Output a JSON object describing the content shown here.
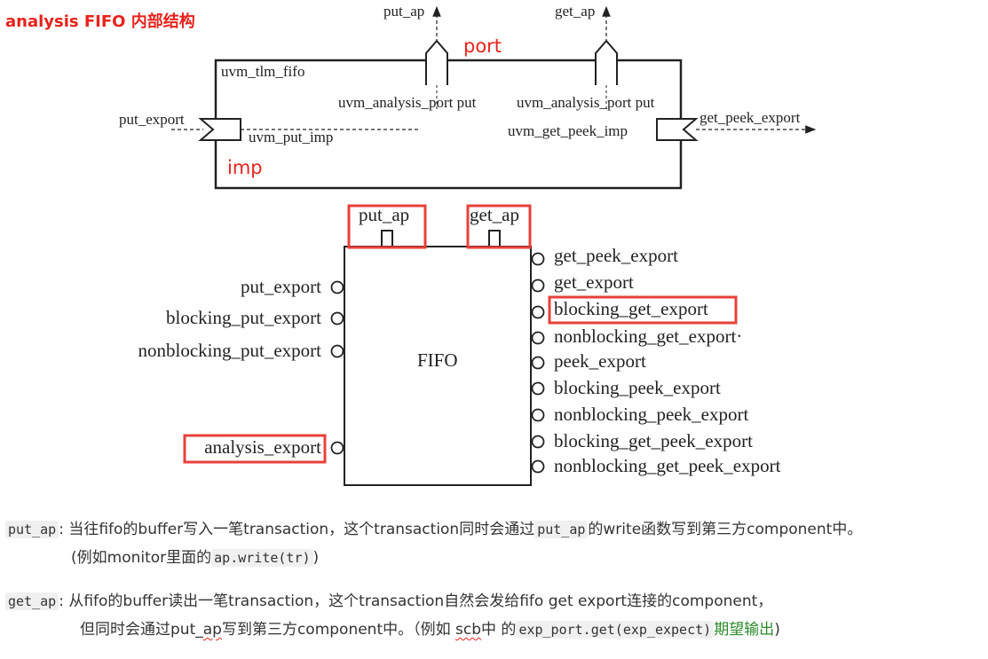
{
  "title": "analysis FIFO 内部结构",
  "diagram1": {
    "put_ap_top": "put_ap",
    "get_ap_top": "get_ap",
    "port_label": "port",
    "fifo_name": "uvm_tlm_fifo",
    "analysis_port_left": "uvm_analysis_port put",
    "analysis_port_right": "uvm_analysis_port put",
    "put_export": "put_export",
    "put_imp": "uvm_put_imp",
    "get_peek_imp": "uvm_get_peek_imp",
    "get_peek_export": "get_peek_export",
    "imp_label": "imp"
  },
  "diagram2": {
    "center": "FIFO",
    "top_left": "put_ap",
    "top_right": "get_ap",
    "left_ports": [
      "put_export",
      "blocking_put_export",
      "nonblocking_put_export",
      "analysis_export"
    ],
    "right_ports": [
      "get_peek_export",
      "get_export",
      "blocking_get_export",
      "nonblocking_get_export·",
      "peek_export",
      "blocking_peek_export",
      "nonblocking_peek_export",
      "blocking_get_peek_export",
      "nonblocking_get_peek_export"
    ]
  },
  "para1": {
    "code": "put_ap",
    "sep": ": ",
    "text_a": "当往fifo的buffer写入一笔transaction，这个transaction同时会通过",
    "code2": "put_ap",
    "text_b": "的write函数写到第三方component中。",
    "line2_a": "(例如monitor里面的",
    "line2_code": "ap.write(tr)",
    "line2_b": ")"
  },
  "para2": {
    "code": "get_ap",
    "sep": ": ",
    "text_a": "从fifo的buffer读出一笔transaction，这个transaction自然会发给fifo get export连接的component，",
    "line2_a": "但同时会通过put_",
    "line2_ap": "ap",
    "line2_b": "写到第三方component中。（例如 ",
    "line2_scb": "scb",
    "line2_c": "中 的",
    "line2_code": "exp_port.get(exp_expect)",
    "line2_green": "期望输出",
    "line2_d": ")"
  }
}
